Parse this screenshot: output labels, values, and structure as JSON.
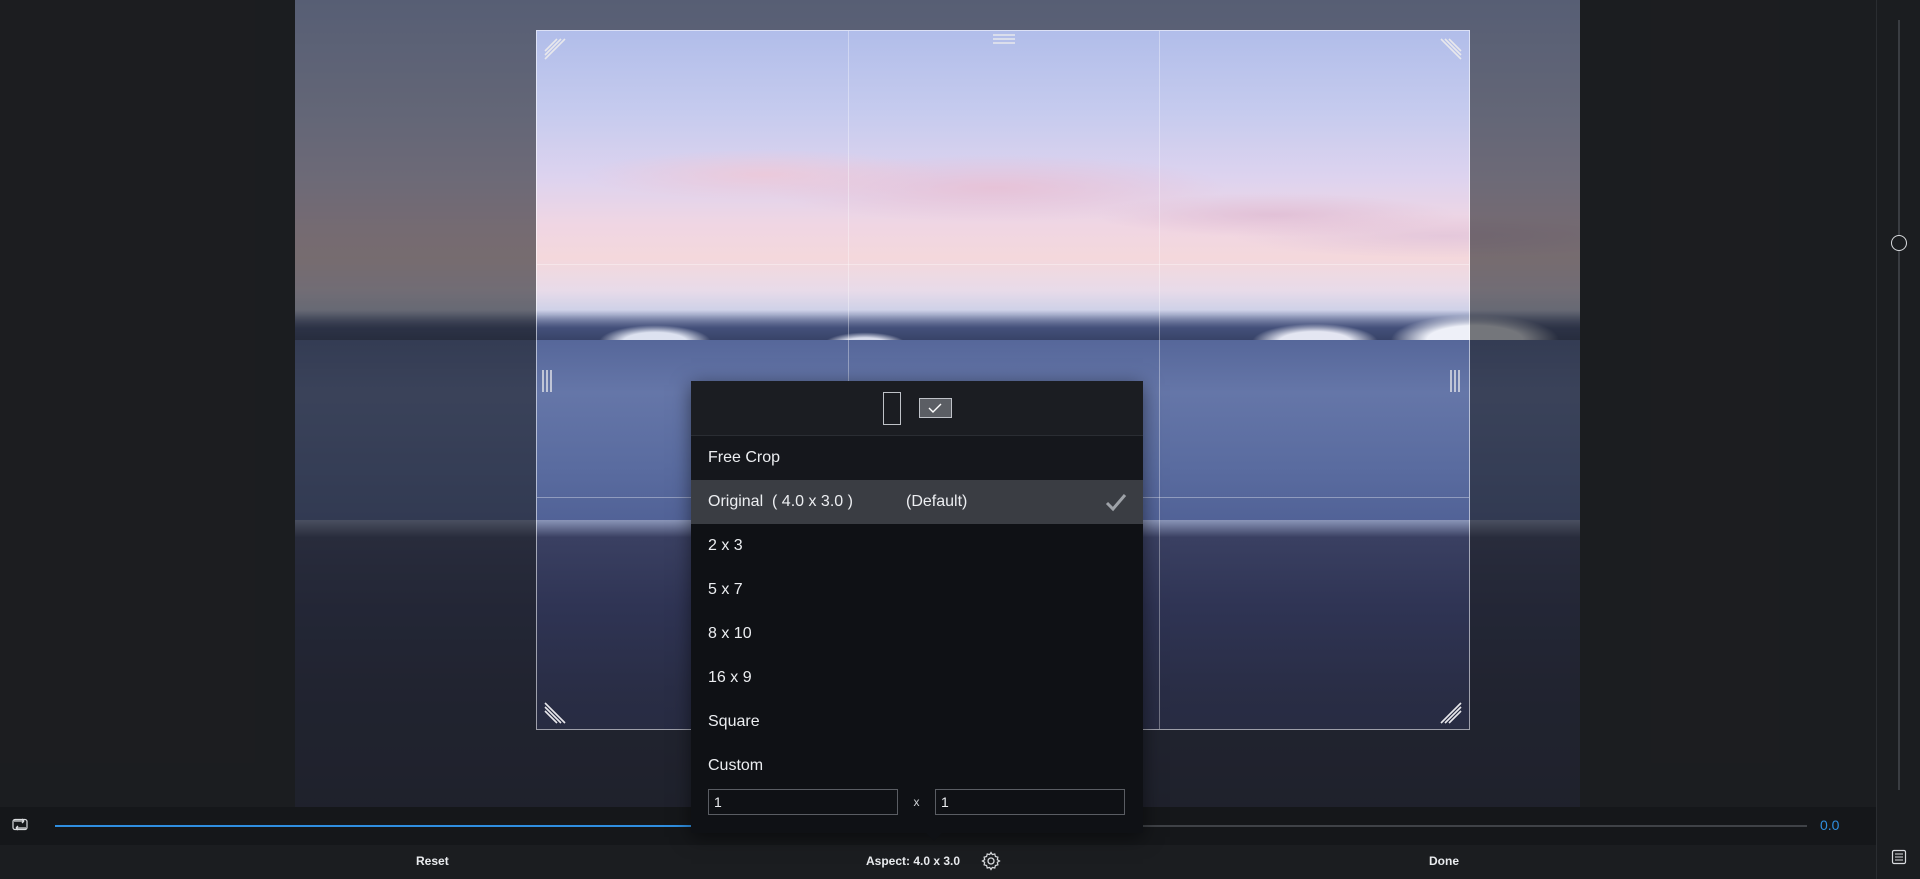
{
  "aspect_menu": {
    "options": [
      {
        "label": "Free Crop"
      },
      {
        "label": "Original  ( 4.0 x 3.0 )",
        "suffix": "(Default)"
      },
      {
        "label": "2 x 3"
      },
      {
        "label": "5 x 7"
      },
      {
        "label": "8 x 10"
      },
      {
        "label": "16 x 9"
      },
      {
        "label": "Square"
      },
      {
        "label": "Custom"
      }
    ],
    "selected_index": 1,
    "custom_width": "1",
    "custom_height": "1",
    "custom_separator": "x",
    "orientation": "landscape"
  },
  "slider": {
    "value": "0.0",
    "fill_fraction": 0.5,
    "accent": "#2f8ee0"
  },
  "bottom_bar": {
    "reset_label": "Reset",
    "aspect_label": "Aspect: 4.0 x 3.0",
    "done_label": "Done"
  },
  "icons": {
    "straighten": "straighten-icon",
    "gear": "gear-icon",
    "checkmark": "checkmark-icon",
    "panel": "panel-icon"
  }
}
